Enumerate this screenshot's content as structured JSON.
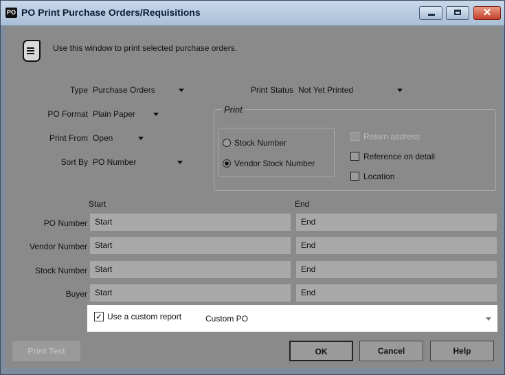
{
  "window": {
    "title": "PO Print Purchase Orders/Requisitions",
    "app_icon_text": "PO",
    "close_glyph": "✕"
  },
  "header": {
    "text": "Use this window to print selected purchase orders."
  },
  "fields": {
    "type": {
      "label": "Type",
      "value": "Purchase Orders"
    },
    "po_format": {
      "label": "PO Format",
      "value": "Plain Paper"
    },
    "print_from": {
      "label": "Print From",
      "value": "Open"
    },
    "sort_by": {
      "label": "Sort By",
      "value": "PO Number"
    },
    "print_status": {
      "label": "Print Status",
      "value": "Not Yet Printed"
    }
  },
  "print_group": {
    "title": "Print",
    "radios": [
      {
        "label": "Stock Number",
        "selected": false
      },
      {
        "label": "Vendor Stock Number",
        "selected": true
      }
    ],
    "checkboxes": [
      {
        "label": "Return address",
        "checked": false,
        "enabled": false
      },
      {
        "label": "Reference on detail",
        "checked": false,
        "enabled": true
      },
      {
        "label": "Location",
        "checked": false,
        "enabled": true
      }
    ]
  },
  "range": {
    "start_header": "Start",
    "end_header": "End",
    "rows": [
      {
        "label": "PO Number",
        "start": "Start",
        "end": "End"
      },
      {
        "label": "Vendor Number",
        "start": "Start",
        "end": "End"
      },
      {
        "label": "Stock Number",
        "start": "Start",
        "end": "End"
      },
      {
        "label": "Buyer",
        "start": "Start",
        "end": "End"
      }
    ]
  },
  "custom_report": {
    "label": "Use a custom report",
    "checked": true,
    "check_glyph": "✓",
    "value": "Custom PO"
  },
  "buttons": {
    "print_test": "Print Test",
    "ok": "OK",
    "cancel": "Cancel",
    "help": "Help"
  }
}
